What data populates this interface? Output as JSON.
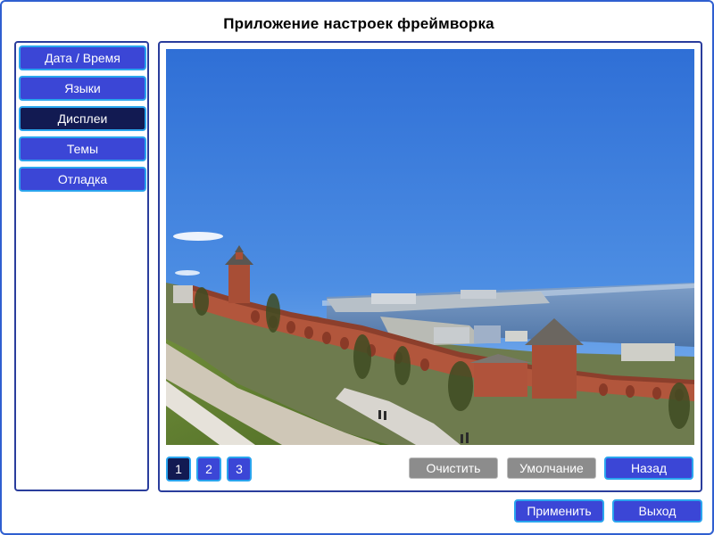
{
  "app": {
    "title": "Приложение настроек фреймворка"
  },
  "sidebar": {
    "items": [
      {
        "label": "Дата / Время",
        "active": false
      },
      {
        "label": "Языки",
        "active": false
      },
      {
        "label": "Дисплеи",
        "active": true
      },
      {
        "label": "Темы",
        "active": false
      },
      {
        "label": "Отладка",
        "active": false
      }
    ]
  },
  "content": {
    "pages": [
      "1",
      "2",
      "3"
    ],
    "active_page": "1",
    "clear_label": "Очистить",
    "default_label": "Умолчание",
    "back_label": "Назад"
  },
  "footer": {
    "apply_label": "Применить",
    "exit_label": "Выход"
  },
  "colors": {
    "button_blue": "#3b46d6",
    "button_active": "#121a52",
    "button_border": "#2aa5ee",
    "button_gray": "#8c8c8c",
    "frame_border": "#2f5fd0",
    "panel_border": "#2a3d9c"
  }
}
